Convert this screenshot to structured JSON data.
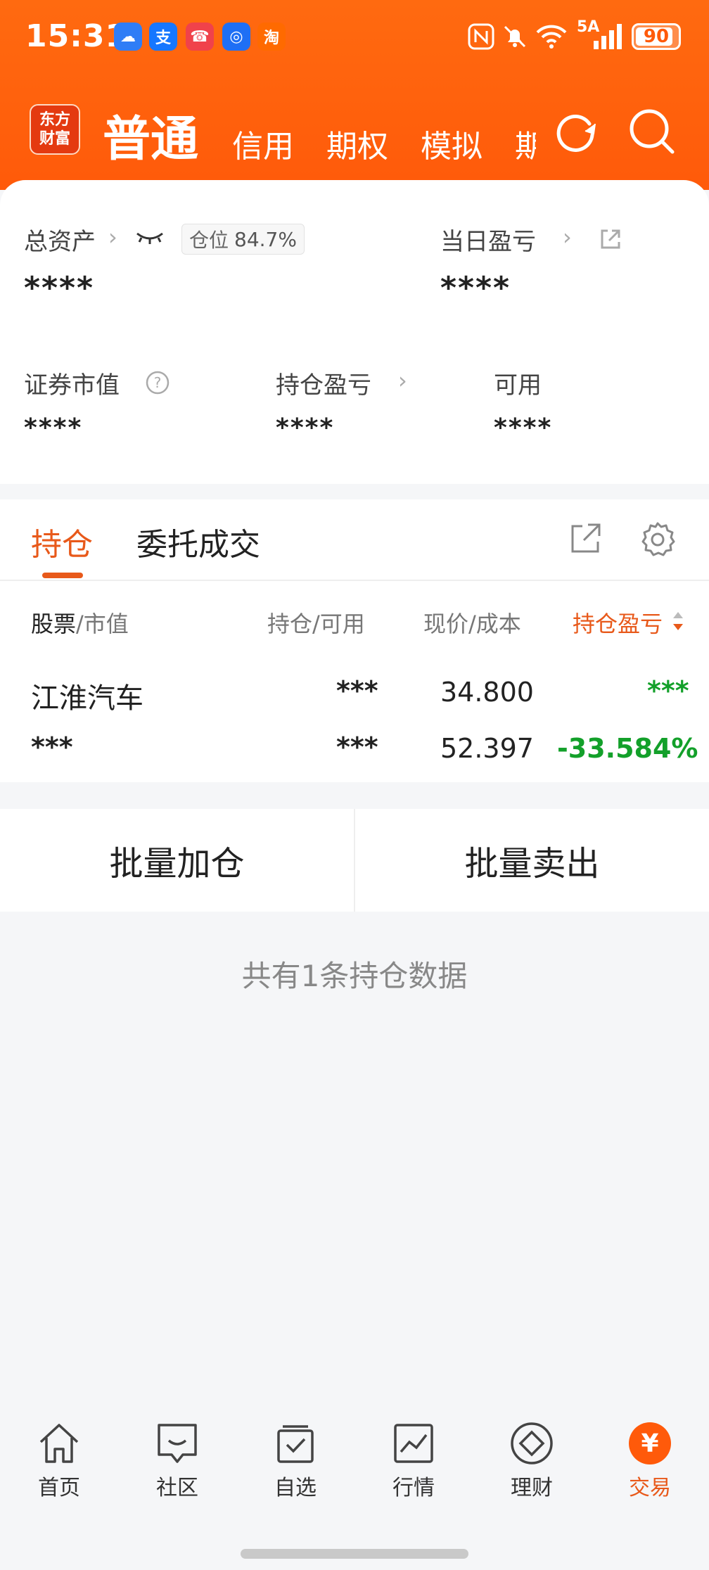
{
  "status_bar": {
    "time": "15:31",
    "apps": [
      {
        "icon": "weather-icon",
        "glyph": "☁",
        "color": "#2f7df6"
      },
      {
        "icon": "alipay-icon",
        "glyph": "支",
        "color": "#1677ff"
      },
      {
        "icon": "phone-icon",
        "glyph": "☎",
        "color": "#f0424b"
      },
      {
        "icon": "chat-icon",
        "glyph": "◎",
        "color": "#1e6ff5"
      },
      {
        "icon": "taobao-icon",
        "glyph": "淘",
        "color": "#ff6a00"
      }
    ],
    "network": "5A",
    "battery": "90"
  },
  "header": {
    "logo": {
      "line1": "东方",
      "line2": "财富"
    },
    "tabs": [
      {
        "label": "普通",
        "active": true
      },
      {
        "label": "信用"
      },
      {
        "label": "期权"
      },
      {
        "label": "模拟"
      },
      {
        "label": "期"
      }
    ],
    "icons": [
      "refresh-icon",
      "search-icon"
    ]
  },
  "summary": {
    "total_assets_label": "总资产",
    "position_badge_label": "仓位",
    "position_badge_value": "84.7%",
    "total_assets_value": "****",
    "daily_pnl_label": "当日盈亏",
    "daily_pnl_value": "****",
    "market_value_label": "证券市值",
    "market_value_value": "****",
    "holding_pnl_label": "持仓盈亏",
    "holding_pnl_value": "****",
    "available_label": "可用",
    "available_value": "****"
  },
  "positions": {
    "tabs": [
      {
        "label": "持仓",
        "active": true
      },
      {
        "label": "委托成交"
      }
    ],
    "columns": {
      "stock": "股票",
      "stock_sub": "/市值",
      "holding": "持仓/可用",
      "price": "现价/成本",
      "pnl": "持仓盈亏"
    },
    "rows": [
      {
        "name": "江淮汽车",
        "market_value": "***",
        "holding": "***",
        "available": "***",
        "price": "34.800",
        "cost": "52.397",
        "pnl": "***",
        "pnl_pct": "-33.584%"
      }
    ]
  },
  "actions": {
    "batch_add": "批量加仓",
    "batch_sell": "批量卖出"
  },
  "footer_note": "共有1条持仓数据",
  "bottom_nav": [
    {
      "label": "首页",
      "icon": "home-icon"
    },
    {
      "label": "社区",
      "icon": "community-icon"
    },
    {
      "label": "自选",
      "icon": "watchlist-icon"
    },
    {
      "label": "行情",
      "icon": "market-icon"
    },
    {
      "label": "理财",
      "icon": "wealth-icon"
    },
    {
      "label": "交易",
      "icon": "trade-icon",
      "active": true
    }
  ],
  "colors": {
    "brand": "#ff5a0a",
    "accent": "#e8591a",
    "gain_green": "#13a02a"
  }
}
